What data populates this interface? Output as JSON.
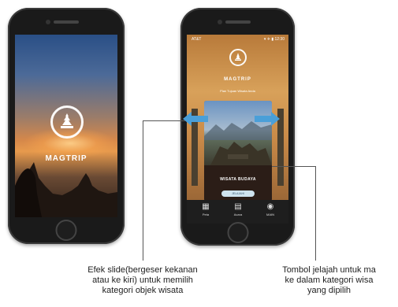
{
  "splash_screen": {
    "app_name": "MAGTRIP"
  },
  "category_screen": {
    "status_bar": {
      "carrier": "AT&T",
      "time": "▾ ✈ ▮ 12:30"
    },
    "app_name": "MAGTRIP",
    "tagline": "Plan Tujuan Wisata Anda",
    "card_title": "WISATA BUDAYA",
    "explore_button": "JELAJAHI",
    "page_dots": "● ● ● ● ●",
    "tabs": [
      {
        "label": "Peta",
        "icon": "map-icon"
      },
      {
        "label": "Acara",
        "icon": "calendar-icon"
      },
      {
        "label": "MAIN",
        "icon": "eye-icon"
      }
    ]
  },
  "annotations": {
    "slide_caption": [
      "Efek slide(bergeser kekanan",
      "atau ke kiri) untuk memilih",
      "kategori objek wisata"
    ],
    "explore_caption": [
      "Tombol jelajah untuk ma",
      "ke dalam kategori wisa",
      "yang dipilih"
    ]
  },
  "colors": {
    "arrow": "#4a9fd8",
    "tabbar": "#1e1e1e",
    "explore_button": "#cfe3ee"
  }
}
